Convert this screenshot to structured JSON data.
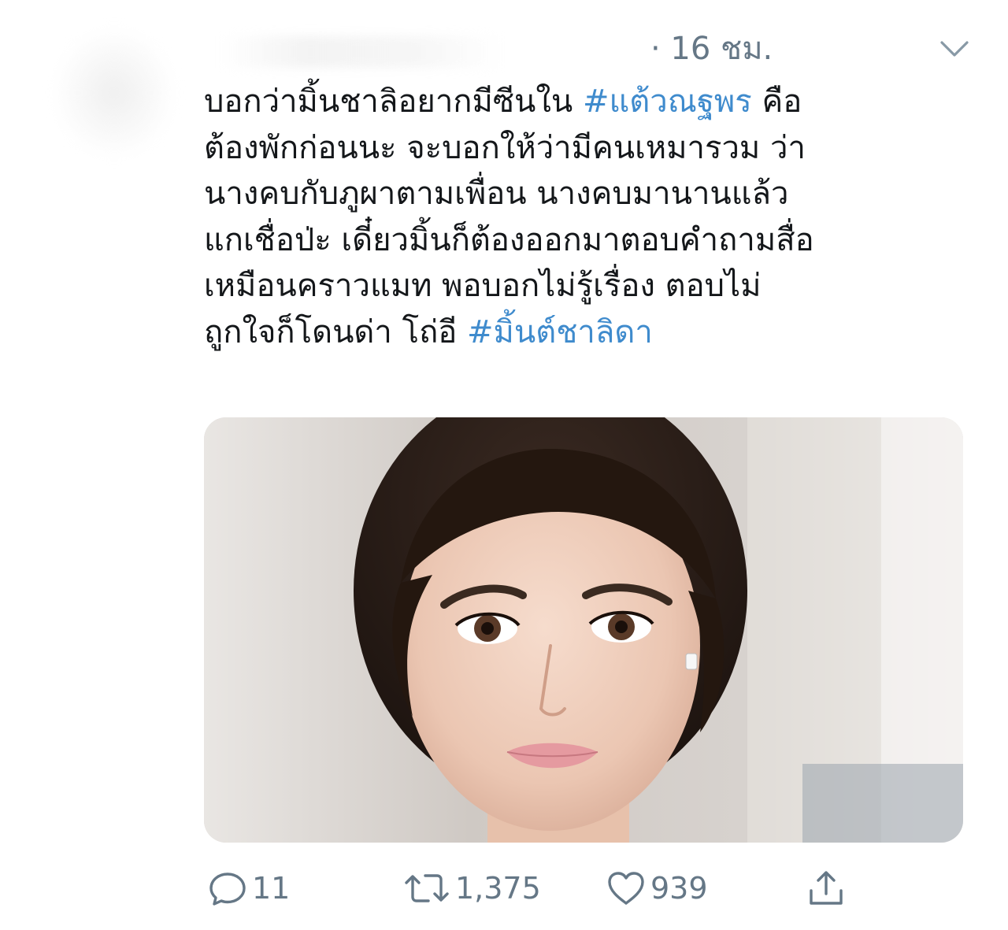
{
  "tweet": {
    "timestamp": "· 16 ชม.",
    "text_lines": [
      [
        {
          "text": "บอกว่ามิ้นชาลิอยากมีซีนใน "
        },
        {
          "hashtag": "#แต้วณฐพร"
        },
        {
          "text": " คือ"
        }
      ],
      [
        {
          "text": "ต้องพักก่อนนะ จะบอกให้ว่ามีคนเหมารวม ว่า"
        }
      ],
      [
        {
          "text": "นางคบกับภูผาตามเพื่อน นางคบมานานแล้ว"
        }
      ],
      [
        {
          "text": "แกเชื่อป่ะ เดี๋ยวมิ้นก็ต้องออกมาตอบคำถามสื่อ"
        }
      ],
      [
        {
          "text": "เหมือนคราวแมท พอบอกไม่รู้เรื่อง ตอบไม่"
        }
      ],
      [
        {
          "text": "ถูกใจก็โดนด่า  โถ่อี  "
        },
        {
          "hashtag": "#มิ้นต์ชาลิดา"
        }
      ]
    ]
  },
  "actions": {
    "reply_count": "11",
    "retweet_count": "1,375",
    "like_count": "939"
  },
  "icons": {
    "caret": "chevron-down-icon",
    "reply": "reply-icon",
    "retweet": "retweet-icon",
    "like": "heart-icon",
    "share": "share-icon"
  },
  "colors": {
    "hashtag": "#3f8bcd",
    "secondary_text": "#657786",
    "icon": "#657786"
  }
}
